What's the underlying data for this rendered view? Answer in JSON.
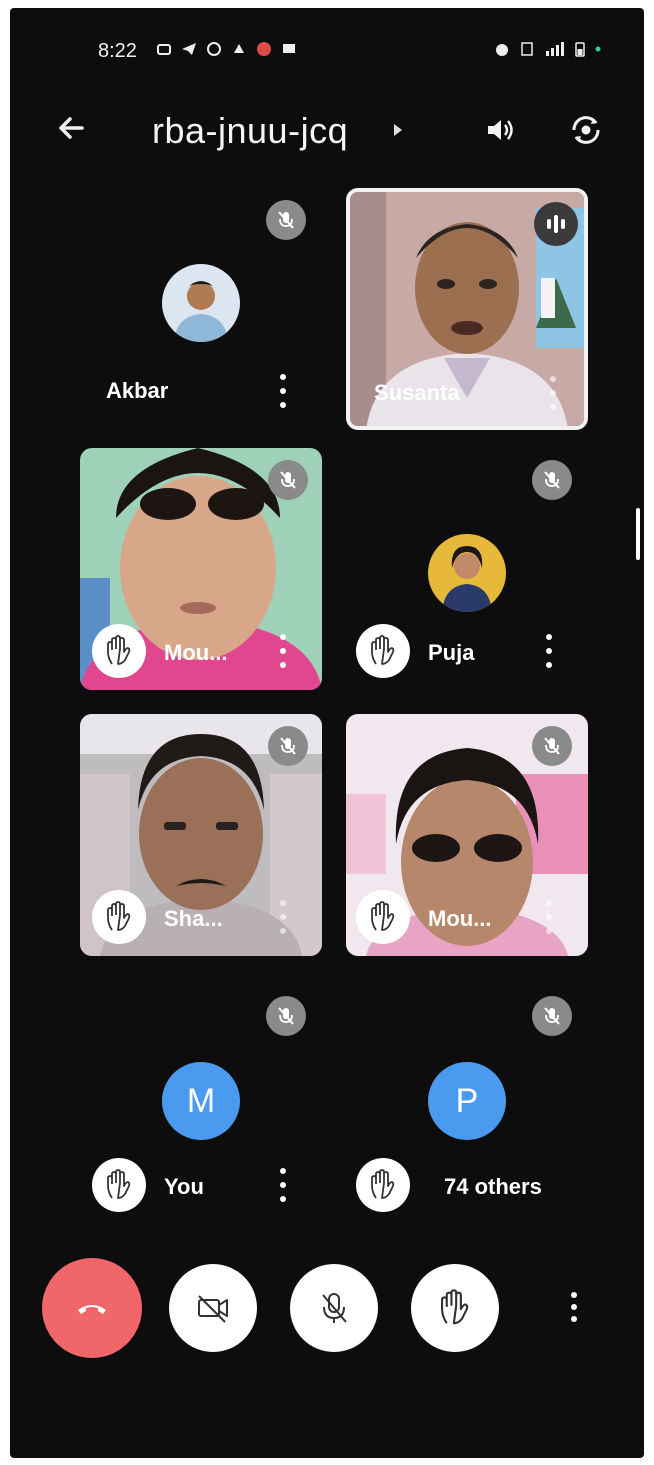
{
  "status_bar": {
    "time": "8:22"
  },
  "header": {
    "meeting_code": "rba-jnuu-jcq"
  },
  "participants": [
    {
      "name": "Akbar"
    },
    {
      "name": "Susanta"
    },
    {
      "name": "Mou..."
    },
    {
      "name": "Puja"
    },
    {
      "name": "Sha..."
    },
    {
      "name": "Mou..."
    },
    {
      "name": "You",
      "avatar_letter": "M"
    },
    {
      "name": "74 others",
      "avatar_letter": "P"
    }
  ],
  "colors": {
    "end_call": "#f0666a",
    "letter_avatar": "#4a9bf0",
    "mute_badge": "#8a8a8a"
  },
  "icons": [
    "arrow-back-icon",
    "speaker-icon",
    "camera-flip-icon",
    "mic-off-icon",
    "raise-hand-icon",
    "more-vert-icon",
    "end-call-icon",
    "video-off-icon",
    "talking-indicator-icon"
  ]
}
